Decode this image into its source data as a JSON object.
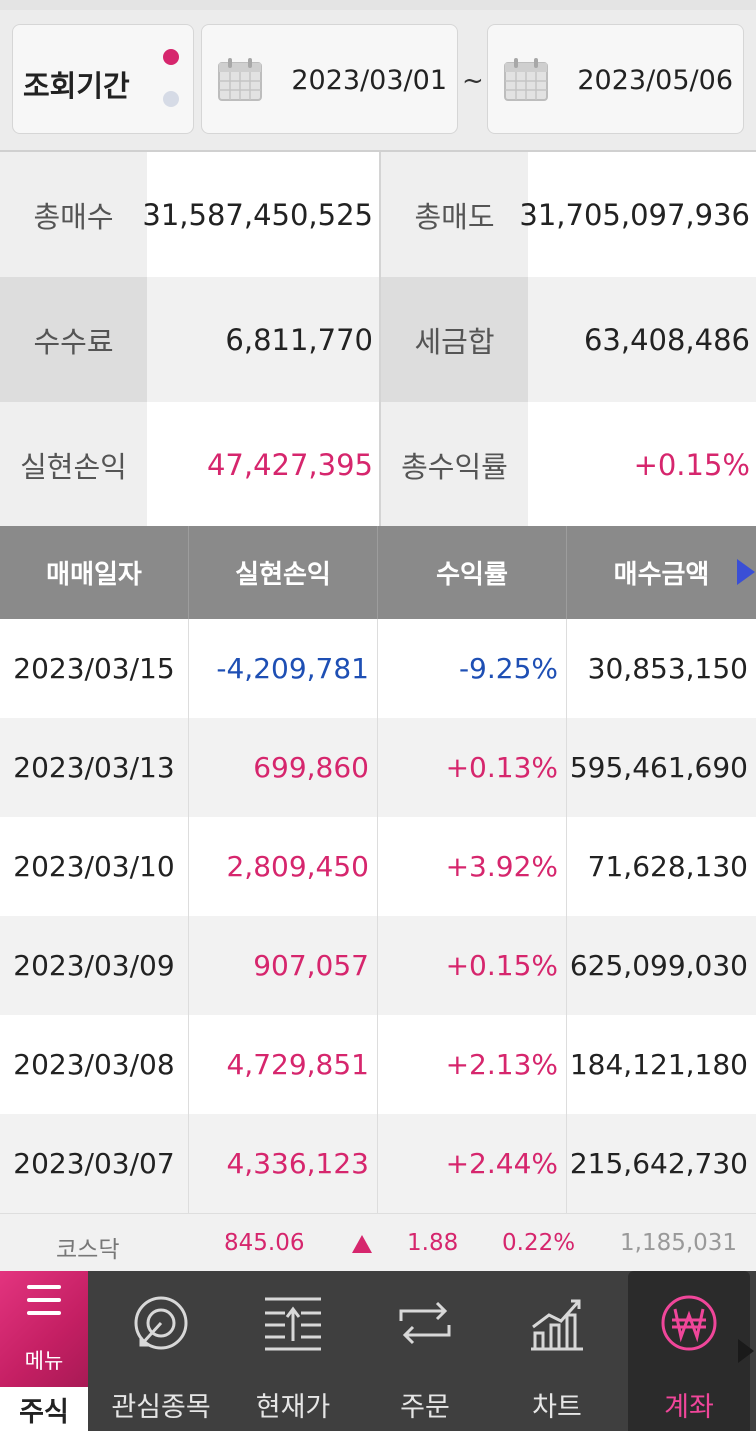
{
  "filter": {
    "period_label": "조회기간",
    "date_from": "2023/03/01",
    "separator": "~",
    "date_to": "2023/05/06"
  },
  "summary": {
    "total_buy_label": "총매수",
    "total_buy": "31,587,450,525",
    "total_sell_label": "총매도",
    "total_sell": "31,705,097,936",
    "fee_label": "수수료",
    "fee": "6,811,770",
    "tax_label": "세금합",
    "tax": "63,408,486",
    "realized_label": "실현손익",
    "realized": "47,427,395",
    "return_label": "총수익률",
    "return": "+0.15%"
  },
  "table": {
    "headers": [
      "매매일자",
      "실현손익",
      "수익률",
      "매수금액"
    ],
    "rows": [
      {
        "date": "2023/03/15",
        "pl": "-4,209,781",
        "rate": "-9.25%",
        "amount": "30,853,150",
        "sign": "neg"
      },
      {
        "date": "2023/03/13",
        "pl": "699,860",
        "rate": "+0.13%",
        "amount": "595,461,690",
        "sign": "pos"
      },
      {
        "date": "2023/03/10",
        "pl": "2,809,450",
        "rate": "+3.92%",
        "amount": "71,628,130",
        "sign": "pos"
      },
      {
        "date": "2023/03/09",
        "pl": "907,057",
        "rate": "+0.15%",
        "amount": "625,099,030",
        "sign": "pos"
      },
      {
        "date": "2023/03/08",
        "pl": "4,729,851",
        "rate": "+2.13%",
        "amount": "184,121,180",
        "sign": "pos"
      },
      {
        "date": "2023/03/07",
        "pl": "4,336,123",
        "rate": "+2.44%",
        "amount": "215,642,730",
        "sign": "pos"
      }
    ]
  },
  "ticker": {
    "name": "코스닥",
    "index": "845.06",
    "change": "1.88",
    "rate": "0.22%",
    "volume": "1,185,031"
  },
  "nav": {
    "menu_label": "메뉴",
    "stock_label": "주식",
    "items": [
      {
        "label": "관심종목",
        "icon": "target-icon"
      },
      {
        "label": "현재가",
        "icon": "price-list-icon"
      },
      {
        "label": "주문",
        "icon": "exchange-arrows-icon"
      },
      {
        "label": "차트",
        "icon": "chart-icon"
      },
      {
        "label": "계좌",
        "icon": "won-coin-icon"
      }
    ]
  },
  "colors": {
    "accent": "#d6266d",
    "negative": "#1e4fb4",
    "header_bg": "#8a8a8a",
    "nav_bg": "#3f3f3f"
  }
}
